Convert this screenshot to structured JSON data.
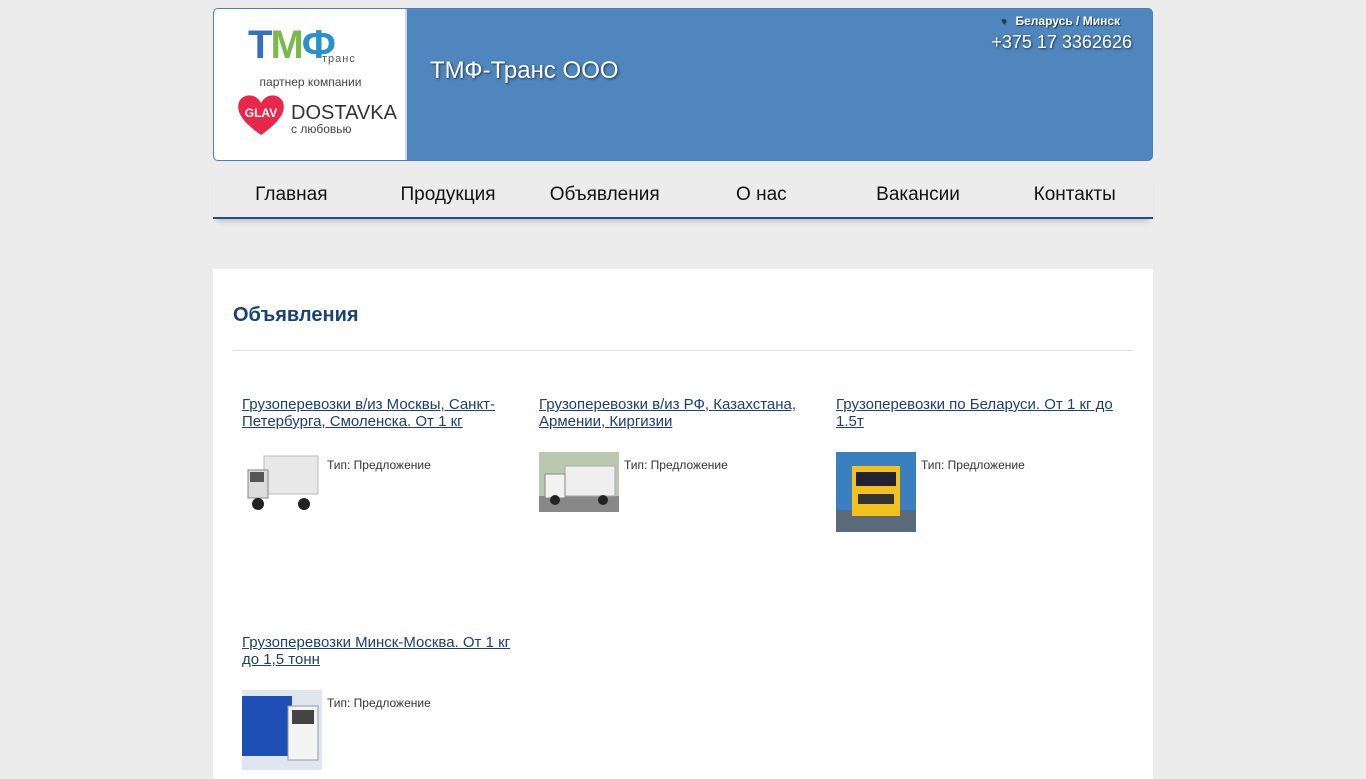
{
  "header": {
    "logo_text": "ТМФ",
    "logo_sub": "транс",
    "partner": "партнер компании",
    "partner_logo": "GLAV",
    "partner_name": "DOSTAVKA",
    "partner_tagline": "с любовью",
    "company": "ТМФ-Транс ООО",
    "region": "Беларусь / Минск",
    "phone": "+375 17 3362626"
  },
  "nav": [
    "Главная",
    "Продукция",
    "Объявления",
    "О нас",
    "Вакансии",
    "Контакты"
  ],
  "main": {
    "title": "Объявления",
    "items": [
      {
        "title": "Грузоперевозки в/из Москвы, Санкт-Петербурга, Смоленска. От 1 кг",
        "type": "Тип: Предложение"
      },
      {
        "title": "Грузоперевозки в/из РФ, Казахстана, Армении, Киргизии",
        "type": "Тип: Предложение"
      },
      {
        "title": "Грузоперевозки по Беларуси. От 1 кг до 1.5т",
        "type": "Тип: Предложение"
      },
      {
        "title": "Грузоперевозки Минск-Москва. От 1 кг до 1,5 тонн",
        "type": "Тип: Предложение"
      }
    ]
  }
}
